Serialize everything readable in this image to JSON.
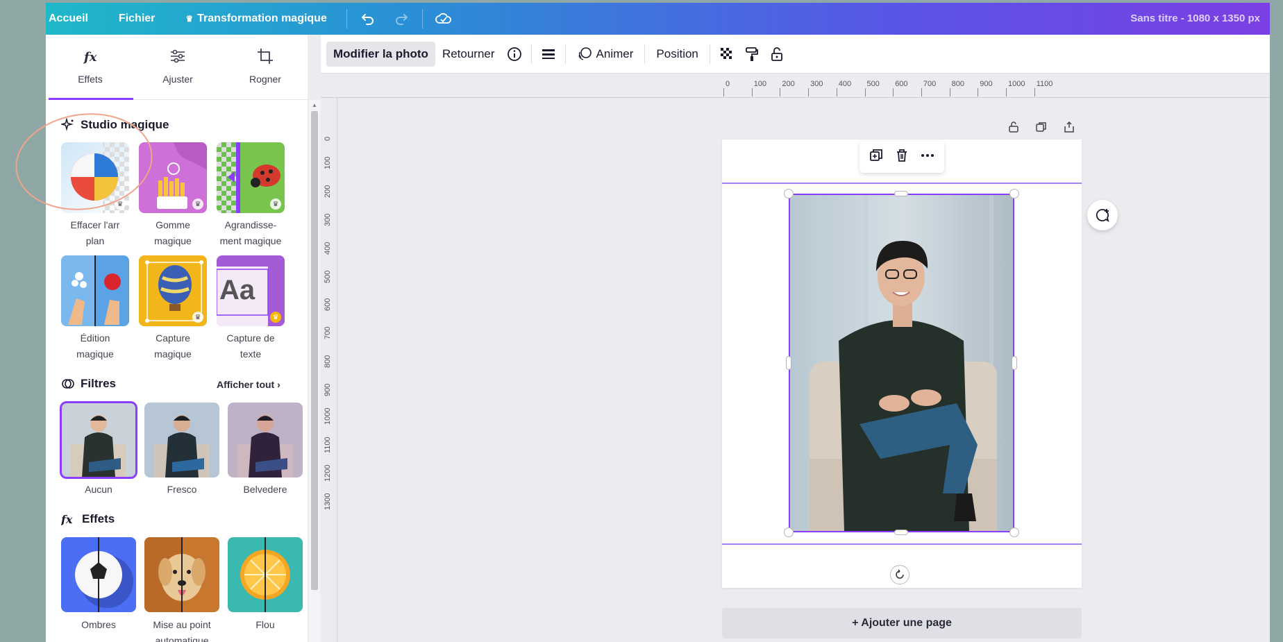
{
  "topbar": {
    "home": "Accueil",
    "file": "Fichier",
    "magic": "Transformation magique",
    "doc_title": "Sans titre - 1080 x 1350 px"
  },
  "panel_tabs": {
    "effects": "Effets",
    "adjust": "Ajuster",
    "crop": "Rogner"
  },
  "magic_studio": {
    "title": "Studio magique",
    "items": [
      {
        "label_1": "Effacer l'arr",
        "label_2": "plan"
      },
      {
        "label_1": "Gomme",
        "label_2": "magique"
      },
      {
        "label_1": "Agrandisse-",
        "label_2": "ment magique"
      },
      {
        "label_1": "Édition",
        "label_2": "magique"
      },
      {
        "label_1": "Capture",
        "label_2": "magique"
      },
      {
        "label_1": "Capture de",
        "label_2": "texte",
        "tile_text": "Aa"
      }
    ]
  },
  "filters": {
    "title": "Filtres",
    "view_all": "Afficher tout",
    "items": [
      {
        "label": "Aucun"
      },
      {
        "label": "Fresco"
      },
      {
        "label": "Belvedere"
      }
    ]
  },
  "effects": {
    "title": "Effets",
    "items": [
      {
        "label_1": "Ombres",
        "label_2": ""
      },
      {
        "label_1": "Mise au point",
        "label_2": "automatique"
      },
      {
        "label_1": "Flou",
        "label_2": ""
      }
    ]
  },
  "toolbar": {
    "edit_photo": "Modifier la photo",
    "flip": "Retourner",
    "animate": "Animer",
    "position": "Position"
  },
  "ruler_top": [
    "0",
    "100",
    "200",
    "300",
    "400",
    "500",
    "600",
    "700",
    "800",
    "900",
    "1000",
    "1100"
  ],
  "ruler_left": [
    "0",
    "100",
    "200",
    "300",
    "400",
    "500",
    "600",
    "700",
    "800",
    "900",
    "1000",
    "1100",
    "1200",
    "1300"
  ],
  "canvas": {
    "add_page": "+ Ajouter une page"
  },
  "colors": {
    "accent": "#8b3dff",
    "annotation": "#f0a48a"
  }
}
